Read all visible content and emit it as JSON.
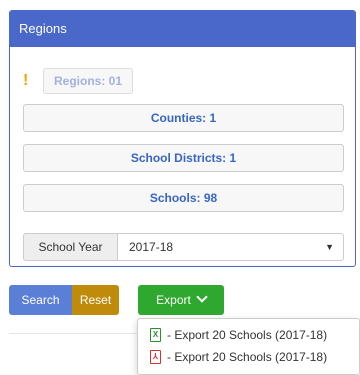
{
  "panel": {
    "title": "Regions",
    "regions_label": "Regions:  01",
    "counties_label": "Counties: 1",
    "districts_label": "School Districts: 1",
    "schools_label": "Schools: 98",
    "school_year_label": "School Year",
    "school_year_value": "2017-18"
  },
  "actions": {
    "search_label": "Search",
    "reset_label": "Reset",
    "export_label": "Export"
  },
  "export_menu": {
    "items": [
      {
        "label": "- Export 20 Schools (2017-18)",
        "icon": "excel-file-icon"
      },
      {
        "label": "- Export 20 Schools (2017-18)",
        "icon": "pdf-file-icon"
      }
    ]
  },
  "colors": {
    "primary": "#4a68c9",
    "warning": "#f0a400",
    "reset": "#c08b0b",
    "export": "#2fa82f"
  }
}
